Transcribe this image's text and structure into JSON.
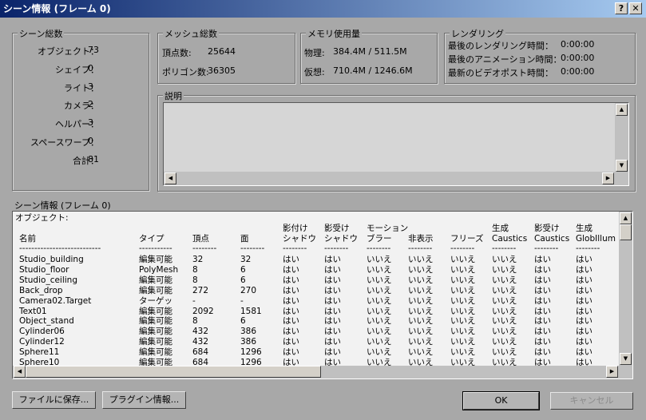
{
  "window": {
    "title": "シーン情報 (フレーム 0)",
    "help": "?",
    "close": "✕"
  },
  "scene_totals": {
    "legend": "シーン総数",
    "items": [
      {
        "label": "オブジェクト：",
        "value": "73"
      },
      {
        "label": "シェイプ：",
        "value": "0"
      },
      {
        "label": "ライト：",
        "value": "3"
      },
      {
        "label": "カメラ：",
        "value": "2"
      },
      {
        "label": "ヘルパー：",
        "value": "3"
      },
      {
        "label": "スペースワープ：",
        "value": "0"
      },
      {
        "label": "合計：",
        "value": "81"
      }
    ]
  },
  "mesh_totals": {
    "legend": "メッシュ総数",
    "vertices_label": "頂点数:",
    "vertices": "25644",
    "polygons_label": "ポリゴン数:",
    "polygons": "36305"
  },
  "memory": {
    "legend": "メモリ使用量",
    "physical_label": "物理:",
    "physical": "384.4M / 511.5M",
    "virtual_label": "仮想:",
    "virtual": "710.4M / 1246.6M"
  },
  "rendering": {
    "legend": "レンダリング",
    "items": [
      {
        "label": "最後のレンダリング時間：",
        "value": "0:00:00"
      },
      {
        "label": "最後のアニメーション時間：",
        "value": "0:00:00"
      },
      {
        "label": "最新のビデオポスト時間：",
        "value": "0:00:00"
      }
    ]
  },
  "description": {
    "legend": "説明",
    "text": ""
  },
  "scene_info": {
    "label": "シーン情報 (フレーム 0)",
    "section": "オブジェクト:",
    "header_top": [
      "",
      "",
      "",
      "",
      "影付け",
      "影受け",
      "モーション",
      "",
      "",
      "生成",
      "影受け",
      "生成"
    ],
    "header_bottom": [
      "名前",
      "タイプ",
      "頂点",
      "面",
      "シャドウ",
      "シャドウ",
      "ブラー",
      "非表示",
      "フリーズ",
      "Caustics",
      "Caustics",
      "GlobIllum"
    ],
    "dashes": [
      "---------------------------",
      "-----------",
      "--------",
      "--------",
      "--------",
      "--------",
      "--------",
      "--------",
      "--------",
      "--------",
      "--------",
      "--------"
    ],
    "rows": [
      [
        "Studio_building",
        "編集可能",
        "32",
        "32",
        "はい",
        "はい",
        "いいえ",
        "いいえ",
        "いいえ",
        "いいえ",
        "はい",
        "はい"
      ],
      [
        "Studio_floor",
        "PolyMesh",
        "8",
        "6",
        "はい",
        "はい",
        "いいえ",
        "いいえ",
        "いいえ",
        "いいえ",
        "はい",
        "はい"
      ],
      [
        "Studio_ceiling",
        "編集可能",
        "8",
        "6",
        "はい",
        "はい",
        "いいえ",
        "いいえ",
        "いいえ",
        "いいえ",
        "はい",
        "はい"
      ],
      [
        "Back_drop",
        "編集可能",
        "272",
        "270",
        "はい",
        "はい",
        "いいえ",
        "いいえ",
        "いいえ",
        "いいえ",
        "はい",
        "はい"
      ],
      [
        "Camera02.Target",
        "ターゲッ",
        "-",
        "-",
        "はい",
        "はい",
        "いいえ",
        "いいえ",
        "いいえ",
        "いいえ",
        "はい",
        "はい"
      ],
      [
        "Text01",
        "編集可能",
        "2092",
        "1581",
        "はい",
        "はい",
        "いいえ",
        "いいえ",
        "いいえ",
        "いいえ",
        "はい",
        "はい"
      ],
      [
        "Object_stand",
        "編集可能",
        "8",
        "6",
        "はい",
        "はい",
        "いいえ",
        "いいえ",
        "いいえ",
        "いいえ",
        "はい",
        "はい"
      ],
      [
        "Cylinder06",
        "編集可能",
        "432",
        "386",
        "はい",
        "はい",
        "いいえ",
        "いいえ",
        "いいえ",
        "いいえ",
        "はい",
        "はい"
      ],
      [
        "Cylinder12",
        "編集可能",
        "432",
        "386",
        "はい",
        "はい",
        "いいえ",
        "いいえ",
        "いいえ",
        "いいえ",
        "はい",
        "はい"
      ],
      [
        "Sphere11",
        "編集可能",
        "684",
        "1296",
        "はい",
        "はい",
        "いいえ",
        "いいえ",
        "いいえ",
        "いいえ",
        "はい",
        "はい"
      ],
      [
        "Sphere10",
        "編集可能",
        "684",
        "1296",
        "はい",
        "はい",
        "いいえ",
        "いいえ",
        "いいえ",
        "いいえ",
        "はい",
        "はい"
      ]
    ]
  },
  "buttons": {
    "save": "ファイルに保存...",
    "plugin": "プラグイン情報...",
    "ok": "OK",
    "cancel": "キャンセル"
  }
}
